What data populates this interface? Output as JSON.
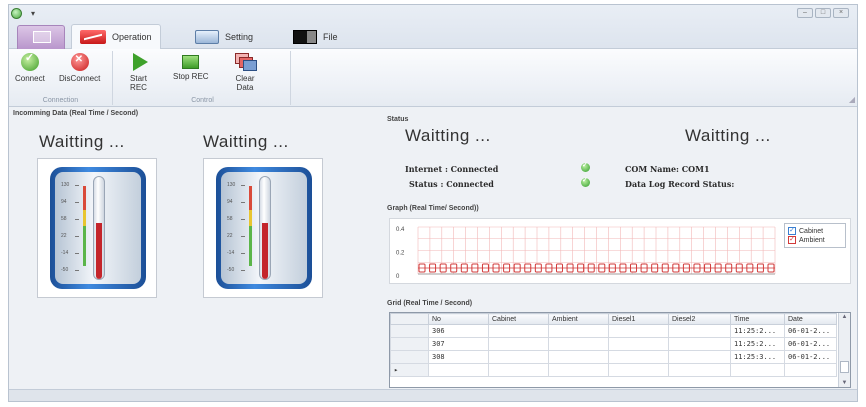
{
  "tabs": [
    {
      "label": "Operation",
      "icon": "chart-icon",
      "active": true
    },
    {
      "label": "Setting",
      "icon": "settings-monitor-icon",
      "active": false
    },
    {
      "label": "File",
      "icon": "file-toggle-icon",
      "active": false
    }
  ],
  "ribbon": {
    "connection_group": {
      "caption": "Connection",
      "connect_label": "Connect",
      "disconnect_label": "DisConnect"
    },
    "control_group": {
      "caption": "Control",
      "start_rec_label": "Start\nREC",
      "stop_rec_label": "Stop REC",
      "clear_data_label": "Clear\nData"
    }
  },
  "incoming": {
    "title": "Incomming Data (Real Time / Second)",
    "gauges": [
      {
        "waiting": "Waitting ...",
        "level": 0.55
      },
      {
        "waiting": "Waitting ...",
        "level": 0.55
      }
    ],
    "scale_ticks": [
      "130",
      "94",
      "58",
      "22",
      "-14",
      "-50"
    ]
  },
  "status": {
    "title": "Status",
    "waiting_left": "Waitting ...",
    "waiting_right": "Waitting ...",
    "internet": "Internet : Connected",
    "status": "Status : Connected",
    "com_name": "COM Name: COM1",
    "data_log": "Data Log Record Status:"
  },
  "graph": {
    "title": "Graph (Real Time/ Second))",
    "y_ticks": [
      "0.4",
      "0.2",
      "0"
    ],
    "legend": [
      {
        "name": "Cabinet",
        "color": "#3b7fd1"
      },
      {
        "name": "Ambient",
        "color": "#d23a3a"
      }
    ],
    "point_count": 34
  },
  "grid": {
    "title": "Grid (Real Time / Second)",
    "columns": [
      "No",
      "Cabinet",
      "Ambient",
      "Diesel1",
      "Diesel2",
      "Time",
      "Date"
    ],
    "rows": [
      {
        "no": "306",
        "cabinet": "",
        "ambient": "",
        "diesel1": "",
        "diesel2": "",
        "time": "11:25:2...",
        "date": "06-01-2..."
      },
      {
        "no": "307",
        "cabinet": "",
        "ambient": "",
        "diesel1": "",
        "diesel2": "",
        "time": "11:25:2...",
        "date": "06-01-2..."
      },
      {
        "no": "308",
        "cabinet": "",
        "ambient": "",
        "diesel1": "",
        "diesel2": "",
        "time": "11:25:3...",
        "date": "06-01-2..."
      }
    ],
    "new_row_marker": "▸"
  }
}
